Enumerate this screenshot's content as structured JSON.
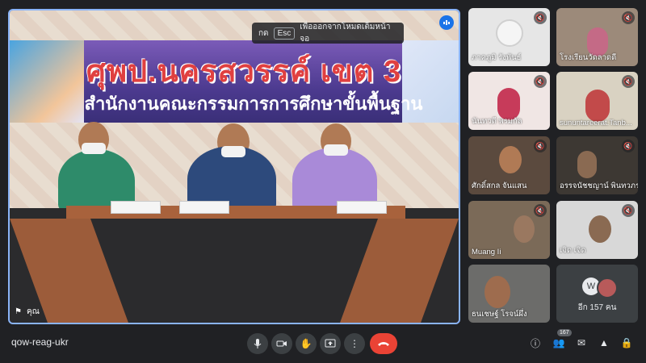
{
  "main": {
    "banner_title": "ศุพป.นครสวรรค์ เขต 3",
    "banner_subtitle": "สำนักงานคณะกรรมการการศึกษาขั้นพื้นฐาน",
    "esc_prefix": "กด",
    "esc_key": "Esc",
    "esc_text": "เพื่อออกจากโหมดเต็มหน้าจอ",
    "tile_label": "คุณ"
  },
  "participants": [
    {
      "name": "ภาคภูมิ รังพันธ์"
    },
    {
      "name": "โรงเรียนวัดลาดดี"
    },
    {
      "name": "นันทวดี พรมกัล"
    },
    {
      "name": "sununtareerat.Tanb..."
    },
    {
      "name": "ศักดิ์สกล จันแสน"
    },
    {
      "name": "อรรจนัชชญาน์ พินทวภรณ์"
    },
    {
      "name": "Muang Ii"
    },
    {
      "name": "เจิด เจิด"
    },
    {
      "name": "ธนเชษฐ์ โรจน์ผึ่ง"
    }
  ],
  "more_tile": {
    "label": "อีก 157 คน",
    "initial": "W"
  },
  "bottom": {
    "meeting_code": "qow-reag-ukr",
    "participant_count": "167"
  },
  "colors": {
    "accent": "#8ab4f8",
    "end_call": "#ea4335",
    "background": "#202124"
  }
}
